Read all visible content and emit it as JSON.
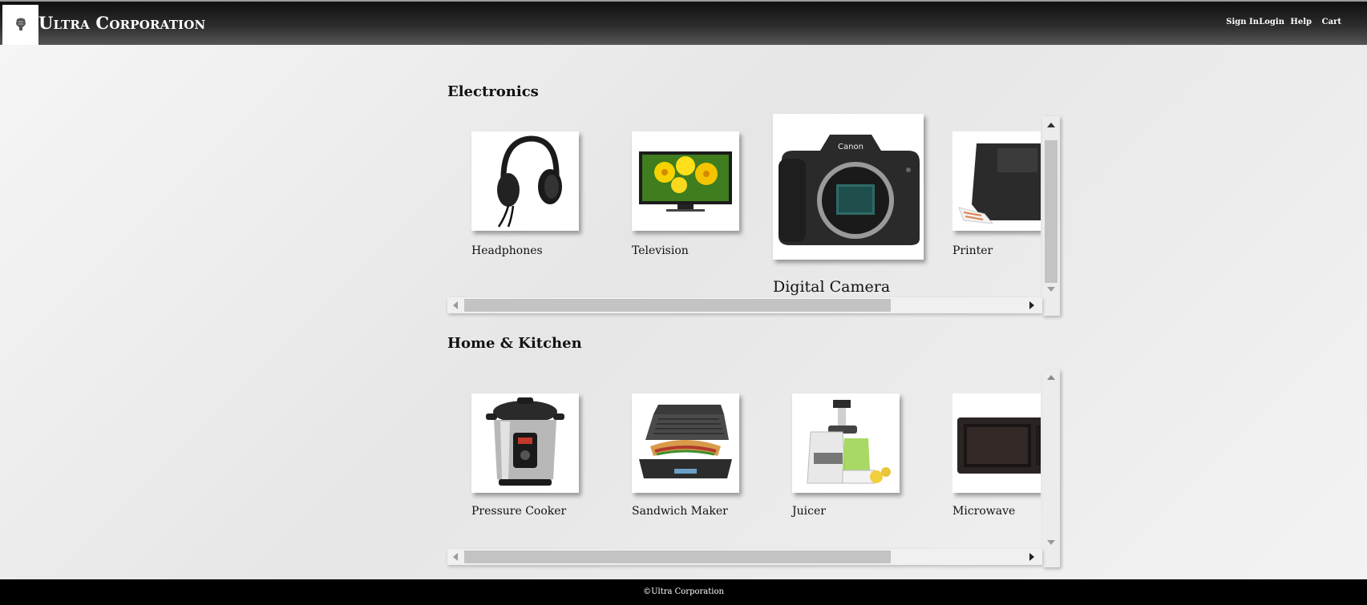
{
  "header": {
    "brand": "Ultra Corporation",
    "nav": [
      "Sign In",
      "Login",
      "Help",
      "Cart"
    ]
  },
  "sections": [
    {
      "title": "Electronics",
      "items": [
        "Headphones",
        "Television",
        "Digital Camera",
        "Printer"
      ]
    },
    {
      "title": "Home & Kitchen",
      "items": [
        "Pressure Cooker",
        "Sandwich Maker",
        "Juicer",
        "Microwave"
      ]
    }
  ],
  "footer": {
    "text": "©Ultra Corporation"
  },
  "icons": {
    "logo": "logo-icon",
    "headphones": "headphones-icon",
    "television": "television-icon",
    "camera": "camera-icon",
    "printer": "printer-icon",
    "pressure_cooker": "pressure-cooker-icon",
    "sandwich_maker": "sandwich-maker-icon",
    "juicer": "juicer-icon",
    "microwave": "microwave-icon"
  },
  "colors": {
    "header_dark": "#0f0f0f",
    "footer": "#000000",
    "background": "#eeeeee",
    "scroll_thumb": "#c3c3c3"
  }
}
